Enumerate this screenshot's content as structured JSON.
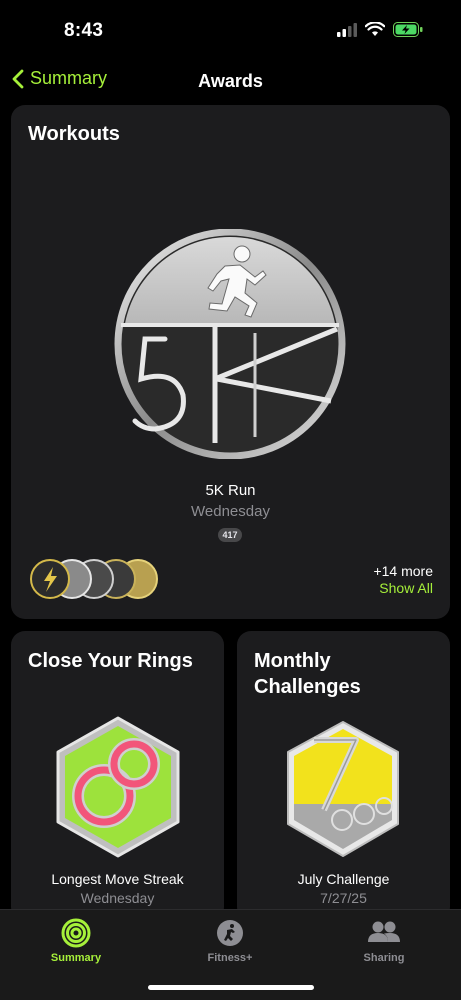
{
  "status_bar": {
    "time": "8:43"
  },
  "nav": {
    "back_label": "Summary",
    "title": "Awards"
  },
  "workouts": {
    "title": "Workouts",
    "featured": {
      "name": "5K Run",
      "date": "Wednesday",
      "count": "417"
    },
    "more": "+14 more",
    "show_all": "Show All"
  },
  "rings": {
    "title": "Close Your Rings",
    "name": "Longest Move Streak",
    "date": "Wednesday"
  },
  "challenges": {
    "title_line1": "Monthly",
    "title_line2": "Challenges",
    "name": "July Challenge",
    "date": "7/27/25"
  },
  "tabs": {
    "summary": "Summary",
    "fitness": "Fitness+",
    "sharing": "Sharing"
  },
  "colors": {
    "accent": "#a6f03a",
    "card": "#1c1c1e",
    "secondary_text": "#8e8e93"
  }
}
